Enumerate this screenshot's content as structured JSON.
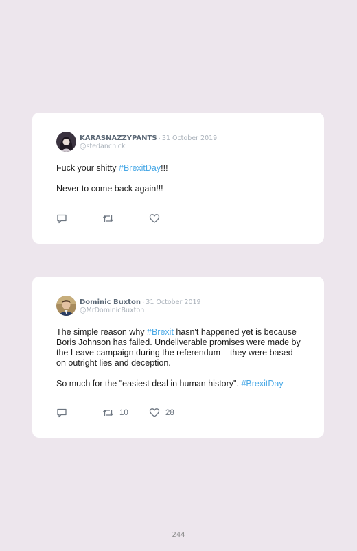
{
  "tweets": [
    {
      "name": "KARASNAZZYPANTS",
      "separator": "·",
      "date": "31 October 2019",
      "handle": "@stedanchick",
      "paragraphs": [
        {
          "text": "Fuck your shitty ",
          "hashtag": "#BrexitDay",
          "after": "!!!"
        },
        {
          "text": "Never to come back again!!!"
        }
      ],
      "retweets": "",
      "likes": ""
    },
    {
      "name": "Dominic Buxton",
      "separator": "·",
      "date": "31 October 2019",
      "handle": "@MrDominicBuxton",
      "paragraphs": [
        {
          "text": "The simple reason why ",
          "hashtag": "#Brexit",
          "after": " hasn't happened yet is because Boris Johnson has failed. Undeliverable promises were made by the Leave campaign during the referendum – they were based on outright lies and deception."
        },
        {
          "text": "So much for the \"easiest deal in human history\". ",
          "hashtag": "#BrexitDay"
        }
      ],
      "retweets": "10",
      "likes": "28"
    }
  ],
  "icons": {
    "reply": "reply-icon",
    "retweet": "retweet-icon",
    "like": "heart-icon"
  },
  "colors": {
    "background": "#ede6ed",
    "hashtag": "#4aa9e6",
    "name": "#5b6876"
  },
  "page_number": "244"
}
